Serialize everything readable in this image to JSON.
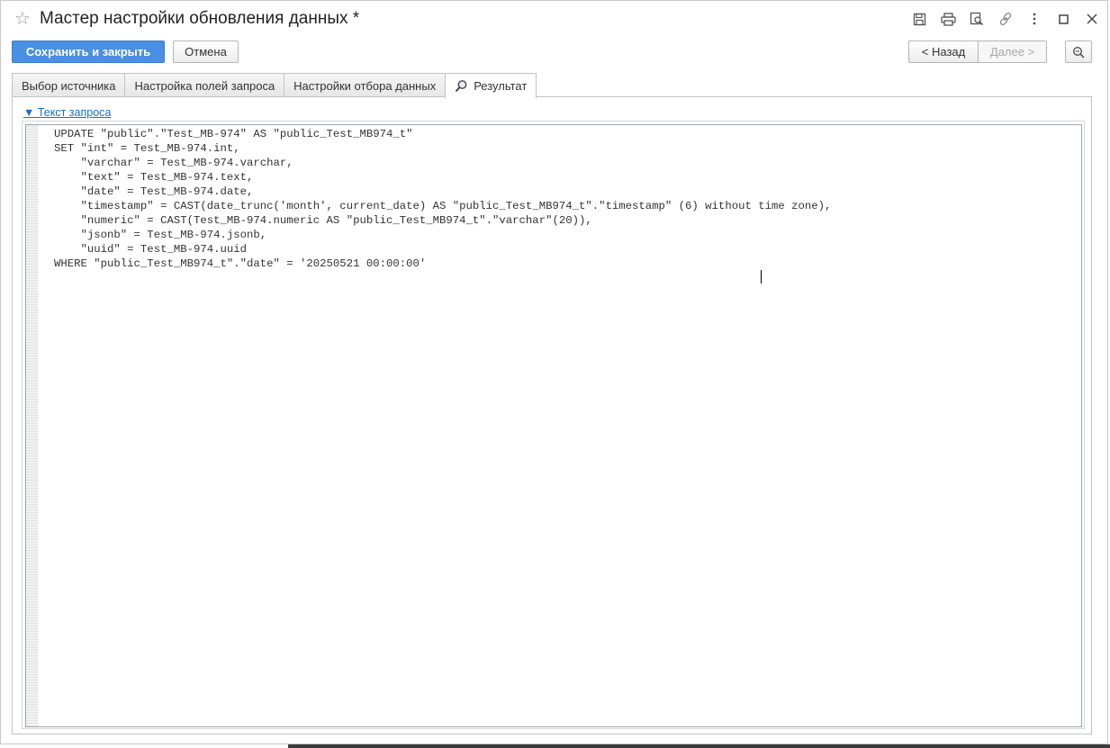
{
  "window": {
    "title": "Мастер настройки обновления данных *"
  },
  "toolbar": {
    "save_close_label": "Сохранить и закрыть",
    "cancel_label": "Отмена",
    "back_label": "< Назад",
    "next_label": "Далее >"
  },
  "tabs": [
    {
      "label": "Выбор источника",
      "active": false
    },
    {
      "label": "Настройка полей запроса",
      "active": false
    },
    {
      "label": "Настройки отбора данных",
      "active": false
    },
    {
      "label": "Результат",
      "active": true
    }
  ],
  "result": {
    "group_label": "▼ Текст запроса",
    "query_lines": [
      "UPDATE \"public\".\"Test_MB-974\" AS \"public_Test_MB974_t\"",
      "SET \"int\" = Test_MB-974.int,",
      "    \"varchar\" = Test_MB-974.varchar,",
      "    \"text\" = Test_MB-974.text,",
      "    \"date\" = Test_MB-974.date,",
      "    \"timestamp\" = CAST(date_trunc('month', current_date) AS \"public_Test_MB974_t\".\"timestamp\" (6) without time zone),",
      "    \"numeric\" = CAST(Test_MB-974.numeric AS \"public_Test_MB974_t\".\"varchar\"(20)),",
      "    \"jsonb\" = Test_MB-974.jsonb,",
      "    \"uuid\" = Test_MB-974.uuid",
      "WHERE \"public_Test_MB974_t\".\"date\" = '20250521 00:00:00'"
    ]
  },
  "icons": {
    "favorite": "star-icon",
    "save": "floppy-disk-icon",
    "print": "printer-icon",
    "preview": "print-preview-icon",
    "link": "link-icon",
    "more": "more-vertical-icon",
    "maximize": "maximize-icon",
    "close": "close-icon",
    "search": "magnifier-icon"
  }
}
